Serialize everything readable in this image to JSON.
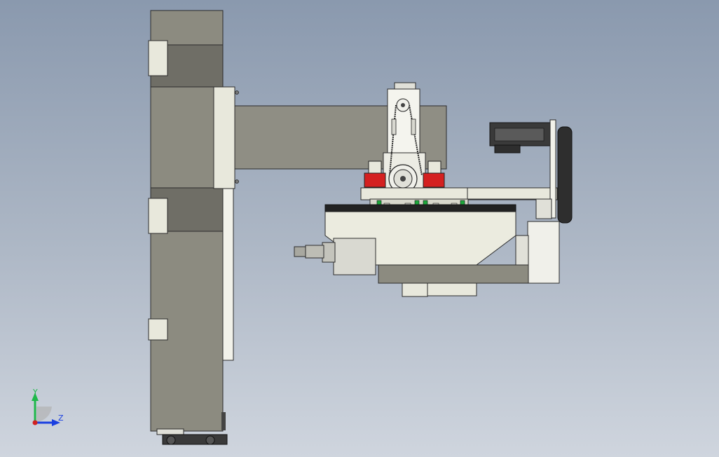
{
  "viewport": {
    "background_top": "#8a99ae",
    "background_bottom": "#cfd5de"
  },
  "triad": {
    "y_label": "Y",
    "z_label": "Z",
    "y_color": "#1fb84a",
    "z_color": "#1a3fe0",
    "origin_color": "#d02020"
  },
  "model": {
    "column_color": "#8c8b80",
    "column_dark_color": "#6f6e66",
    "plate_color": "#e8e8dc",
    "beam_color": "#8f8e84",
    "accent_red": "#d42020",
    "accent_green": "#1ea83c",
    "motor_dark": "#3a3a3a"
  }
}
